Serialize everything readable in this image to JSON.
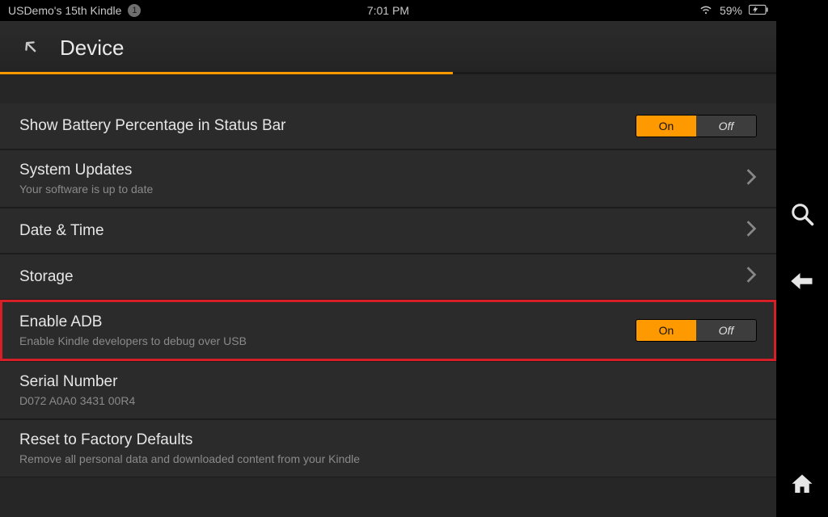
{
  "statusbar": {
    "device_name": "USDemo's 15th Kindle",
    "badge": "1",
    "time": "7:01 PM",
    "battery_pct": "59%"
  },
  "header": {
    "title": "Device"
  },
  "rows": {
    "battery_pct": {
      "label": "Show Battery Percentage in Status Bar",
      "on": "On",
      "off": "Off"
    },
    "system_updates": {
      "label": "System Updates",
      "sub": "Your software is up to date"
    },
    "date_time": {
      "label": "Date & Time"
    },
    "storage": {
      "label": "Storage"
    },
    "enable_adb": {
      "label": "Enable ADB",
      "sub": "Enable Kindle developers to debug over USB",
      "on": "On",
      "off": "Off"
    },
    "serial": {
      "label": "Serial Number",
      "value": "D072 A0A0 3431 00R4"
    },
    "factory_reset": {
      "label": "Reset to Factory Defaults",
      "sub": "Remove all personal data and downloaded content from your Kindle"
    }
  }
}
